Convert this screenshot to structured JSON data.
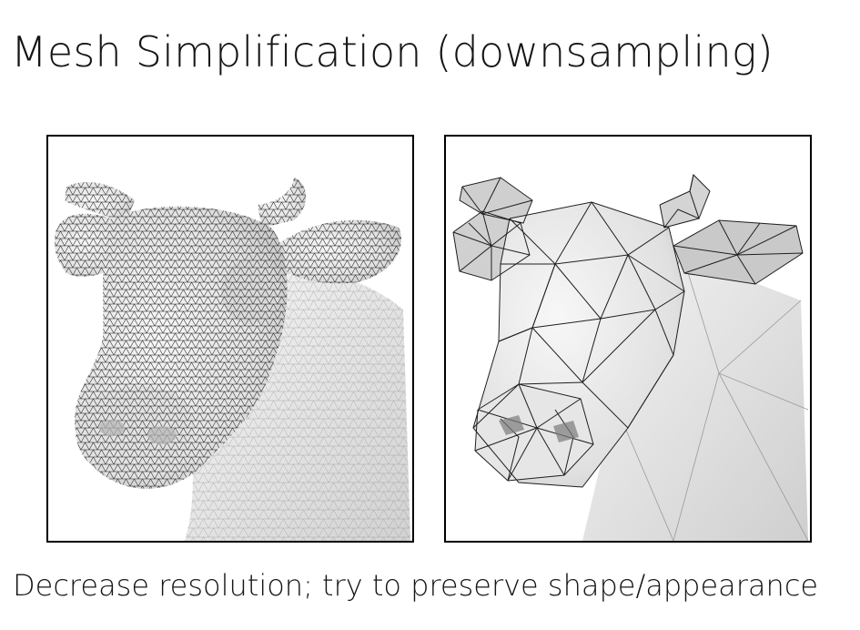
{
  "slide": {
    "title": "Mesh Simplification (downsampling)",
    "caption": "Decrease resolution; try to preserve shape/appearance"
  },
  "figures": [
    {
      "name": "dense-mesh-cow",
      "icon": "cow-head-dense-mesh-icon"
    },
    {
      "name": "simplified-mesh-cow",
      "icon": "cow-head-coarse-mesh-icon"
    }
  ],
  "colors": {
    "frame": "#000000",
    "mesh_line": "#222222",
    "shade_light": "#f2f2f2",
    "shade_mid": "#d9d9d9",
    "shade_dark": "#bdbdbd"
  }
}
